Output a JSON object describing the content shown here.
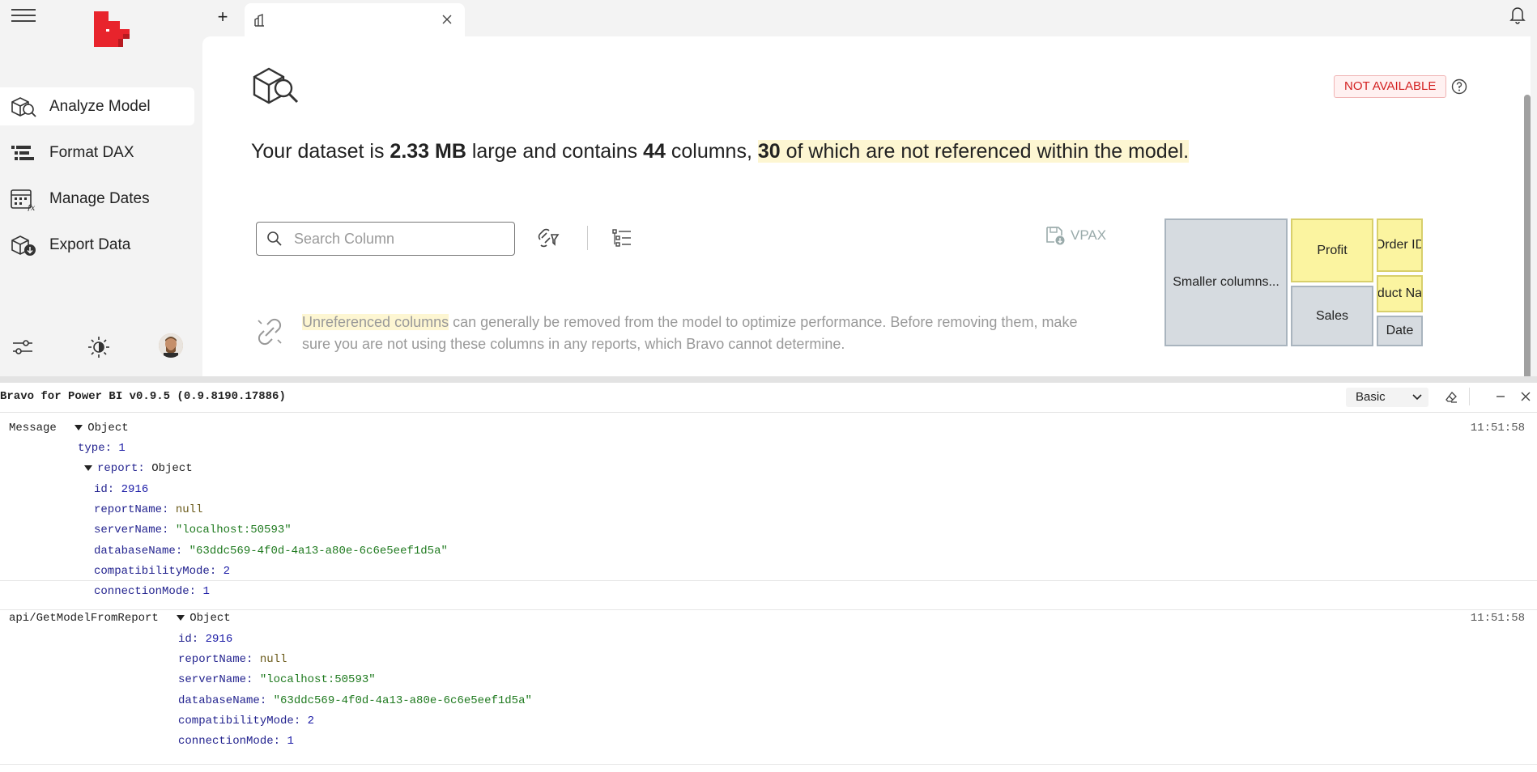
{
  "sidebar": {
    "items": [
      {
        "label": "Analyze Model",
        "icon": "analyze-model-icon",
        "active": true
      },
      {
        "label": "Format DAX",
        "icon": "format-dax-icon",
        "active": false
      },
      {
        "label": "Manage Dates",
        "icon": "manage-dates-icon",
        "active": false
      },
      {
        "label": "Export Data",
        "icon": "export-data-icon",
        "active": false
      }
    ]
  },
  "colors": {
    "brand": "#e8242c",
    "highlight": "#fdf6d2",
    "not_available": "#d32020"
  },
  "content": {
    "badge": "NOT AVAILABLE",
    "headline": {
      "p1": "Your dataset is ",
      "size": "2.33 MB",
      "p2": " large and contains ",
      "columns": "44",
      "p3": " columns, ",
      "unref": "30",
      "p4": " of which are not referenced within the model."
    },
    "search": {
      "placeholder": "Search Column",
      "value": ""
    },
    "vpax_label": "VPAX",
    "info": {
      "highlight": "Unreferenced columns",
      "rest": " can generally be removed from the model to optimize performance. Before removing them, make sure you are not using these columns in any reports, which Bravo cannot determine."
    },
    "treemap": [
      {
        "label": "Smaller columns..."
      },
      {
        "label": "Profit"
      },
      {
        "label": "Order ID"
      },
      {
        "label": "Sales"
      },
      {
        "label": "oduct Nan"
      },
      {
        "label": "Date"
      }
    ]
  },
  "console": {
    "title": "Bravo for Power BI v0.9.5 (0.9.8190.17886)",
    "level": "Basic",
    "messages": [
      {
        "label": "Message",
        "type_word": "Object",
        "time": "11:51:58",
        "type_key": "type:",
        "type_val": "1",
        "report_key": "report:",
        "report_val": "Object",
        "fields": [
          {
            "key": "id:",
            "val": "2916",
            "kind": "num"
          },
          {
            "key": "reportName:",
            "val": "null",
            "kind": "nul"
          },
          {
            "key": "serverName:",
            "val": "\"localhost:50593\"",
            "kind": "str"
          },
          {
            "key": "databaseName:",
            "val": "\"63ddc569-4f0d-4a13-a80e-6c6e5eef1d5a\"",
            "kind": "str"
          },
          {
            "key": "compatibilityMode:",
            "val": "2",
            "kind": "num"
          },
          {
            "key": "connectionMode:",
            "val": "1",
            "kind": "num"
          }
        ]
      },
      {
        "label": "api/GetModelFromReport",
        "type_word": "Object",
        "time": "11:51:58",
        "fields": [
          {
            "key": "id:",
            "val": "2916",
            "kind": "num"
          },
          {
            "key": "reportName:",
            "val": "null",
            "kind": "nul"
          },
          {
            "key": "serverName:",
            "val": "\"localhost:50593\"",
            "kind": "str"
          },
          {
            "key": "databaseName:",
            "val": "\"63ddc569-4f0d-4a13-a80e-6c6e5eef1d5a\"",
            "kind": "str"
          },
          {
            "key": "compatibilityMode:",
            "val": "2",
            "kind": "num"
          },
          {
            "key": "connectionMode:",
            "val": "1",
            "kind": "num"
          }
        ]
      }
    ]
  }
}
